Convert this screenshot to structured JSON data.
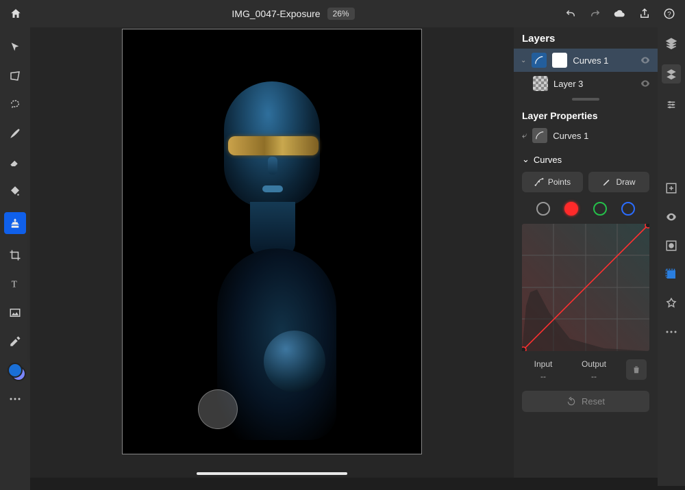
{
  "header": {
    "title": "IMG_0047-Exposure",
    "zoom": "26%"
  },
  "palette": {
    "value": "53"
  },
  "colors": {
    "foreground": "#1a6fd6",
    "background": "#7a86ff"
  },
  "layers": {
    "title": "Layers",
    "items": [
      {
        "name": "Curves 1"
      },
      {
        "name": "Layer 3"
      }
    ]
  },
  "layer_properties": {
    "title": "Layer Properties",
    "name": "Curves 1"
  },
  "curves": {
    "title": "Curves",
    "mode_points": "Points",
    "mode_draw": "Draw",
    "input_label": "Input",
    "output_label": "Output",
    "input_value": "--",
    "output_value": "--",
    "reset": "Reset"
  }
}
